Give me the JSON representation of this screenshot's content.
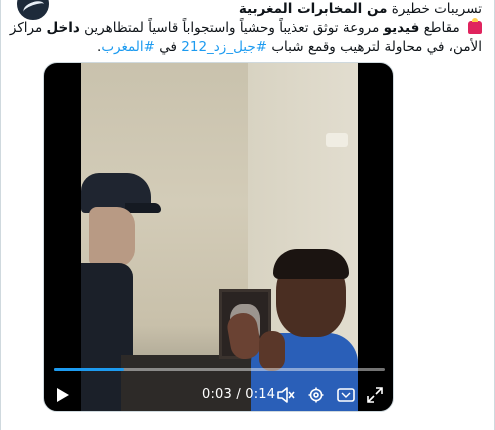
{
  "tweet": {
    "line1_prefix": "تسريبات خطيرة ",
    "line1_bold": "من المخابرات المغربية",
    "line2_a": " مقاطع ",
    "line2_b": "فيديو",
    "line2_c": " مروعة توثق تعذيباً وحشياً واستجواباً قاسياً لمتظاهرين ",
    "line2_d": "داخل",
    "line2_e": " مراكز",
    "line3_a": "الأمن، في محاولة لترهيب وقمع شباب ",
    "line3_hashtag1": "#جيل_زد_212",
    "line3_b": " في ",
    "line3_hashtag2": "#المغرب",
    "line3_c": "."
  },
  "video": {
    "current_time": "0:03",
    "duration": "0:14",
    "time_display": "0:03 / 0:14",
    "progress_fraction": 0.21,
    "play_icon": "play-icon",
    "volume_icon": "volume-muted-icon",
    "settings_icon": "gear-icon",
    "captions_icon": "captions-icon",
    "fullscreen_icon": "fullscreen-icon"
  },
  "colors": {
    "accent": "#1d9bf0",
    "text": "#0f1419",
    "muted": "#536471"
  }
}
